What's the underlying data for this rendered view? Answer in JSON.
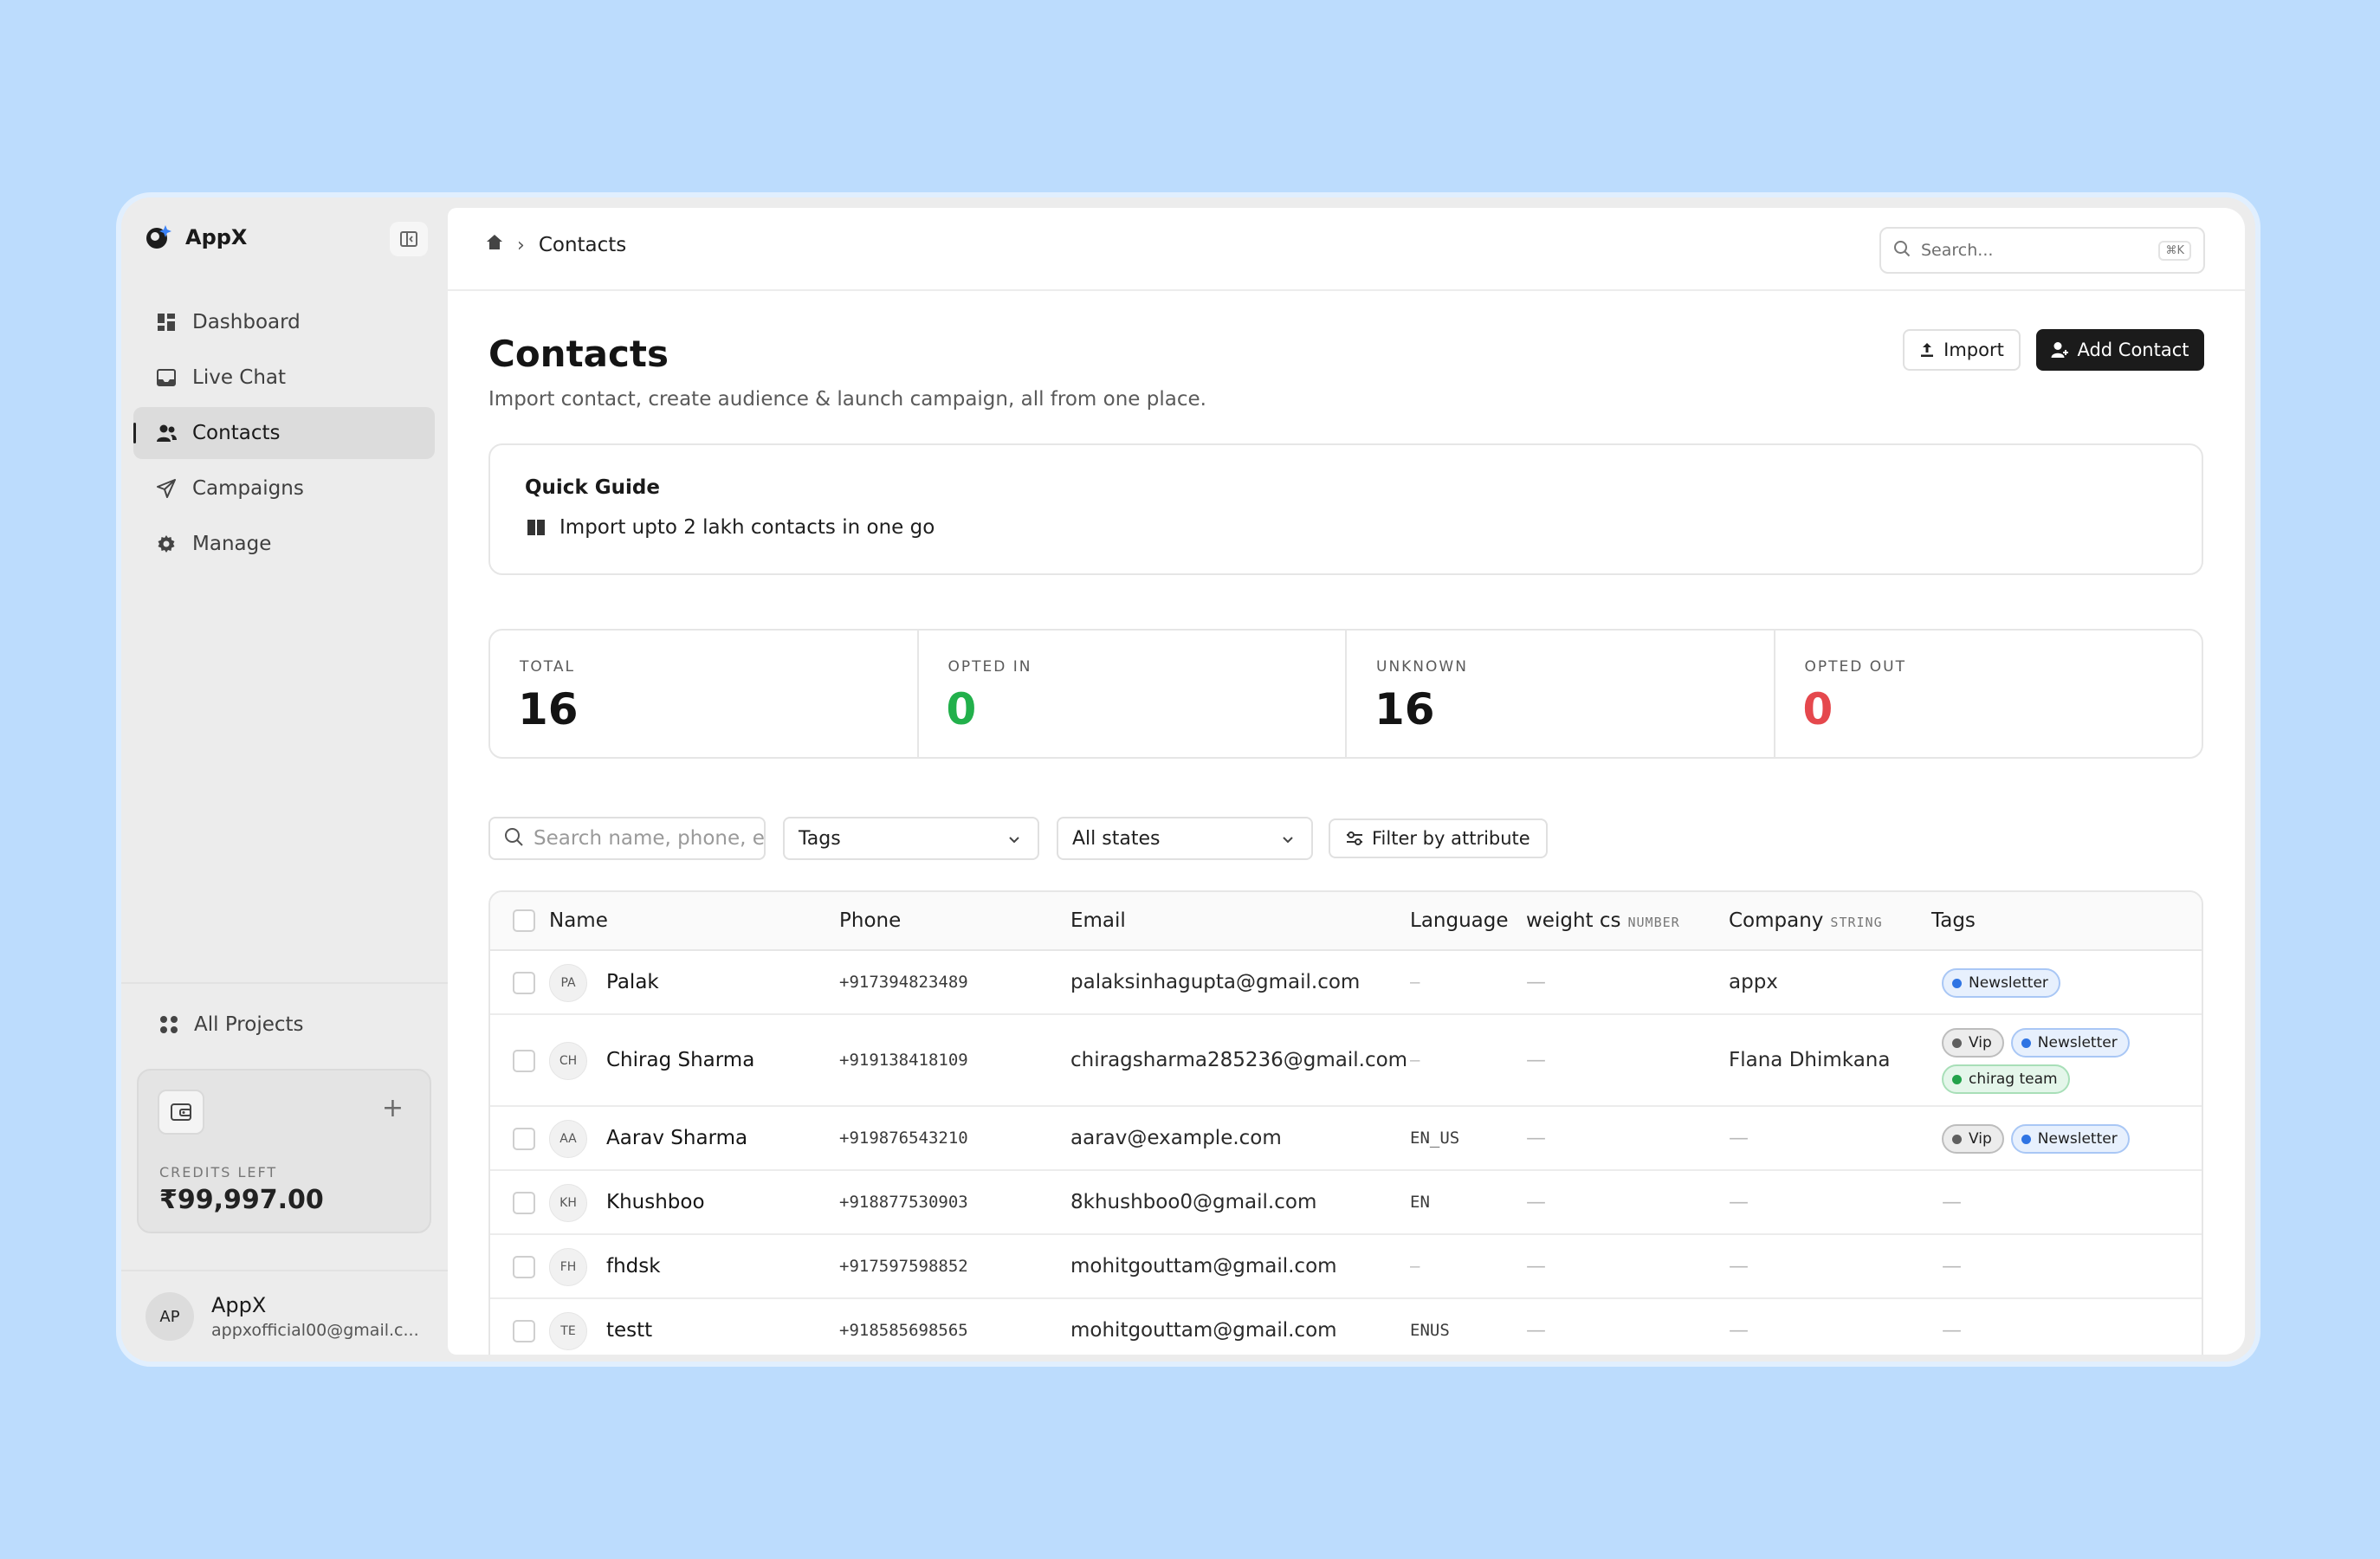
{
  "app": {
    "name": "AppX"
  },
  "sidebar": {
    "items": [
      {
        "label": "Dashboard",
        "icon": "dashboard-icon"
      },
      {
        "label": "Live Chat",
        "icon": "inbox-icon"
      },
      {
        "label": "Contacts",
        "icon": "users-icon",
        "active": true
      },
      {
        "label": "Campaigns",
        "icon": "send-icon"
      },
      {
        "label": "Manage",
        "icon": "gear-icon"
      }
    ],
    "projects_label": "All Projects",
    "credits": {
      "label": "CREDITS LEFT",
      "value": "₹99,997.00"
    },
    "user": {
      "initials": "AP",
      "name": "AppX",
      "email": "appxofficial00@gmail.c..."
    }
  },
  "topbar": {
    "breadcrumb": "Contacts",
    "search_placeholder": "Search...",
    "shortcut": "⌘K"
  },
  "page": {
    "title": "Contacts",
    "subtitle": "Import contact, create audience & launch campaign, all from one place.",
    "import_label": "Import",
    "add_label": "Add Contact"
  },
  "guide": {
    "title": "Quick Guide",
    "item": "Import upto 2 lakh contacts in one go"
  },
  "stats": [
    {
      "label": "TOTAL",
      "value": "16",
      "color": "#141414"
    },
    {
      "label": "OPTED IN",
      "value": "0",
      "color": "#22b04b"
    },
    {
      "label": "UNKNOWN",
      "value": "16",
      "color": "#141414"
    },
    {
      "label": "OPTED OUT",
      "value": "0",
      "color": "#e5484d"
    }
  ],
  "filters": {
    "search_placeholder": "Search name, phone, e",
    "tags_label": "Tags",
    "states_label": "All states",
    "attribute_label": "Filter by attribute"
  },
  "table": {
    "columns": {
      "name": "Name",
      "phone": "Phone",
      "email": "Email",
      "language": "Language",
      "weight": "weight cs",
      "weight_type": "NUMBER",
      "company": "Company",
      "company_type": "STRING",
      "tags": "Tags"
    },
    "empty": "—",
    "rows": [
      {
        "initials": "PA",
        "name": "Palak",
        "phone": "+917394823489",
        "email": "palaksinhagupta@gmail.com",
        "language": "",
        "weight": "",
        "company": "appx",
        "tags": [
          {
            "label": "Newsletter",
            "color": "blue"
          }
        ]
      },
      {
        "initials": "CH",
        "name": "Chirag Sharma",
        "phone": "+919138418109",
        "email": "chiragsharma285236@gmail.com",
        "language": "",
        "weight": "",
        "company": "Flana Dhimkana",
        "tags": [
          {
            "label": "Vip",
            "color": "gray"
          },
          {
            "label": "Newsletter",
            "color": "blue"
          },
          {
            "label": "chirag team",
            "color": "green"
          }
        ]
      },
      {
        "initials": "AA",
        "name": "Aarav Sharma",
        "phone": "+919876543210",
        "email": "aarav@example.com",
        "language": "EN_US",
        "weight": "",
        "company": "",
        "tags": [
          {
            "label": "Vip",
            "color": "gray"
          },
          {
            "label": "Newsletter",
            "color": "blue"
          }
        ]
      },
      {
        "initials": "KH",
        "name": "Khushboo",
        "phone": "+918877530903",
        "email": "8khushboo0@gmail.com",
        "language": "EN",
        "weight": "",
        "company": "",
        "tags": []
      },
      {
        "initials": "FH",
        "name": "fhdsk",
        "phone": "+917597598852",
        "email": "mohitgouttam@gmail.com",
        "language": "",
        "weight": "",
        "company": "",
        "tags": []
      },
      {
        "initials": "TE",
        "name": "testt",
        "phone": "+918585698565",
        "email": "mohitgouttam@gmail.com",
        "language": "ENUS",
        "weight": "",
        "company": "",
        "tags": []
      }
    ]
  }
}
